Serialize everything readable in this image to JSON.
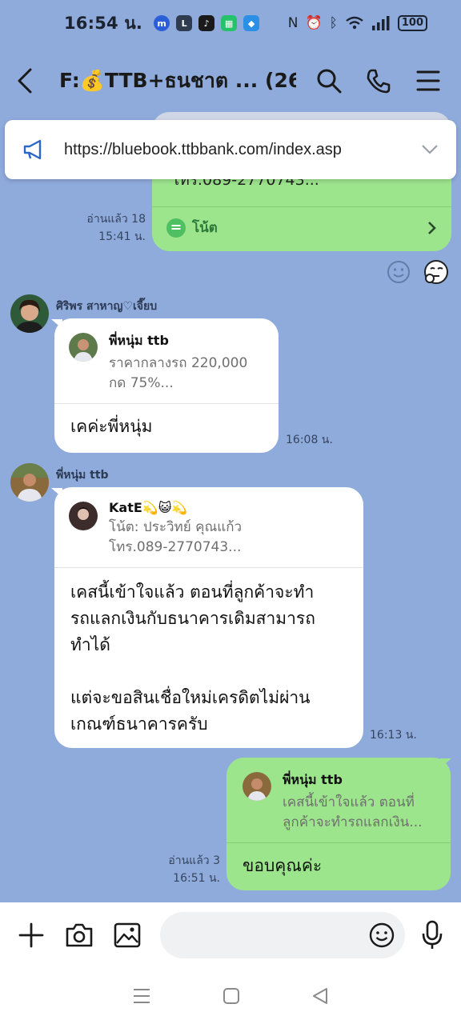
{
  "status": {
    "time": "16:54 น.",
    "battery": "100"
  },
  "header": {
    "title": "F:💰TTB+ธนชาต ...",
    "member_count": "(26)"
  },
  "announcement": {
    "url": "https://bluebook.ttbbank.com/index.asp"
  },
  "messages": [
    {
      "id": "m1",
      "direction": "outgoing",
      "partial_text": "โทร.089-2770743...",
      "note_label": "โน้ต",
      "read": "อ่านแล้ว 18",
      "time": "15:41 น."
    },
    {
      "id": "m2",
      "direction": "incoming",
      "sender": "ศิริพร สาหาญ♡เจี๊ยบ",
      "reply_name": "พี่หนุ่ม ttb",
      "reply_snippet": "ราคากลางรถ 220,000\nกด 75%...",
      "text": "เคค่ะพี่หนุ่ม",
      "time": "16:08 น."
    },
    {
      "id": "m3",
      "direction": "incoming",
      "sender": "พี่หนุ่ม ttb",
      "reply_name": "KatE💫😺💫",
      "reply_snippet": "โน้ต: ประวิทย์ คุณแก้ว\nโทร.089-2770743...",
      "text": "เคสนี้เข้าใจแล้ว ตอนที่ลูกค้าจะทำ\nรถแลกเงินกับธนาคารเดิมสามารถ\nทำได้\n\nแต่จะขอสินเชื่อใหม่เครดิตไม่ผ่าน\nเกณฑ์ธนาคารครับ",
      "time": "16:13 น."
    },
    {
      "id": "m4",
      "direction": "outgoing",
      "reply_name": "พี่หนุ่ม ttb",
      "reply_snippet": "เคสนี้เข้าใจแล้ว ตอนที่\nลูกค้าจะทำรถแลกเงิน...",
      "text": "ขอบคุณค่ะ",
      "read": "อ่านแล้ว 3",
      "time": "16:51 น."
    }
  ],
  "colors": {
    "background": "#8fabdc",
    "outgoing_bubble": "#9de58d",
    "incoming_bubble": "#ffffff",
    "note_icon": "#4fbf63"
  }
}
